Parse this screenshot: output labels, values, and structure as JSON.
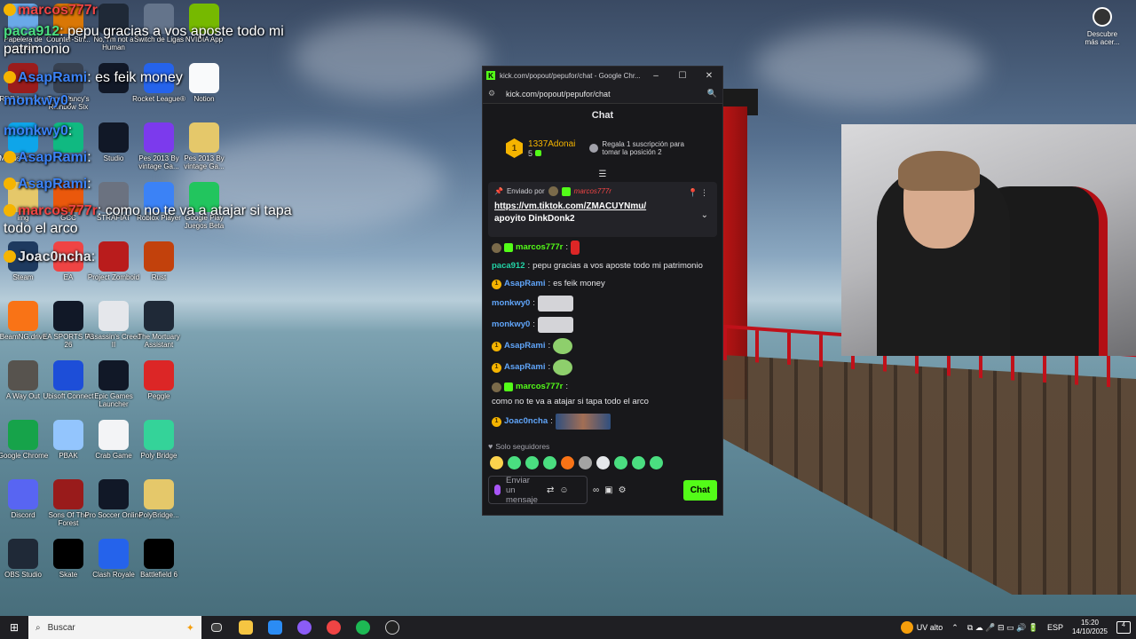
{
  "desktop": {
    "icons": [
      {
        "label": "Papelera de reciclaje",
        "color": "#6aa9e9"
      },
      {
        "label": "Counter-Stri...",
        "color": "#d97706"
      },
      {
        "label": "No, I'm not a Human",
        "color": "#1f2937"
      },
      {
        "label": "Switch de Ligas",
        "color": "#64748b"
      },
      {
        "label": "NVIDIA App",
        "color": "#76b900"
      },
      {
        "label": "RDR Launcher",
        "color": "#9b1c1c"
      },
      {
        "label": "Tom Clancy's Rainbow Six",
        "color": "#374151"
      },
      {
        "label": "",
        "color": "#111827"
      },
      {
        "label": "Rocket League®",
        "color": "#2563eb"
      },
      {
        "label": "Notion",
        "color": "#f9fafb"
      },
      {
        "label": "Microsoft Edge",
        "color": "#0ea5e9"
      },
      {
        "label": "App",
        "color": "#10b981"
      },
      {
        "label": "Studio",
        "color": "#111827"
      },
      {
        "label": "Pes 2013 By vintage Ga...",
        "color": "#7c3aed"
      },
      {
        "label": "Pes 2013 By vintage Ga...",
        "color": "#e5c86a"
      },
      {
        "label": "img",
        "color": "#e5c86a"
      },
      {
        "label": "GCC",
        "color": "#ea580c"
      },
      {
        "label": "STRAFIAT",
        "color": "#6b7280"
      },
      {
        "label": "Roblox Player",
        "color": "#3b82f6"
      },
      {
        "label": "Google Play Juegos Beta",
        "color": "#22c55e"
      },
      {
        "label": "Steam",
        "color": "#1e3a5f"
      },
      {
        "label": "EA",
        "color": "#ef4444"
      },
      {
        "label": "Project Zomboid",
        "color": "#b91c1c"
      },
      {
        "label": "Rust",
        "color": "#c2410c"
      },
      {
        "label": "BeamNG.drive",
        "color": "#f97316"
      },
      {
        "label": "EA SPORTS FC 26",
        "color": "#111827"
      },
      {
        "label": "Assassin's Creed II",
        "color": "#e5e7eb"
      },
      {
        "label": "The Mortuary Assistant",
        "color": "#1f2937"
      },
      {
        "label": "A Way Out",
        "color": "#57534e"
      },
      {
        "label": "Ubisoft Connect",
        "color": "#1d4ed8"
      },
      {
        "label": "Epic Games Launcher",
        "color": "#111827"
      },
      {
        "label": "Peggle",
        "color": "#dc2626"
      },
      {
        "label": "Google Chrome",
        "color": "#16a34a"
      },
      {
        "label": "PBAK",
        "color": "#93c5fd"
      },
      {
        "label": "Crab Game",
        "color": "#f3f4f6"
      },
      {
        "label": "Poly Bridge",
        "color": "#34d399"
      },
      {
        "label": "Discord",
        "color": "#5865f2"
      },
      {
        "label": "Sons Of The Forest",
        "color": "#991b1b"
      },
      {
        "label": "Pro Soccer Online",
        "color": "#111827"
      },
      {
        "label": "PolyBridge...",
        "color": "#e5c86a"
      },
      {
        "label": "OBS Studio",
        "color": "#1f2937"
      },
      {
        "label": "Skate",
        "color": "#000000"
      },
      {
        "label": "Clash Royale",
        "color": "#2563eb"
      },
      {
        "label": "Battlefield 6",
        "color": "#000000"
      }
    ],
    "discover": "Descubre más acer..."
  },
  "overlay": [
    {
      "name": "marcos777r",
      "text": ""
    },
    {
      "name": "paca912",
      "text": "pepu gracias a vos aposte todo mi patrimonio"
    },
    {
      "name": "AsapRami",
      "text": "es feik money"
    },
    {
      "name": "monkwy0",
      "text": ""
    },
    {
      "name": "monkwy0",
      "text": ""
    },
    {
      "name": "AsapRami",
      "text": ""
    },
    {
      "name": "AsapRami",
      "text": ""
    },
    {
      "name": "marcos777r",
      "text": "como no te va a atajar si tapa todo el arco"
    },
    {
      "name": "Joac0ncha",
      "text": ""
    }
  ],
  "browser": {
    "title": "kick.com/popout/pepufor/chat - Google Chr...",
    "url": "kick.com/popout/pepufor/chat",
    "chat_title": "Chat",
    "leader": {
      "name": "1337Adonai",
      "count": "5",
      "rank": "1",
      "gift_text": "Regala 1 suscripción para tomar la posición 2"
    },
    "pinned": {
      "sent_by": "Enviado por",
      "user": "marcos777r",
      "link": "https://vm.tiktok.com/ZMACUYNmu/",
      "text": "apoyito DinkDonk2"
    },
    "messages": [
      {
        "user": "marcos777r",
        "text": ""
      },
      {
        "user": "paca912",
        "text": "pepu gracias a vos aposte todo mi patrimonio"
      },
      {
        "user": "AsapRami",
        "text": "es feik money"
      },
      {
        "user": "monkwy0",
        "text": ""
      },
      {
        "user": "monkwy0",
        "text": ""
      },
      {
        "user": "AsapRami",
        "text": ""
      },
      {
        "user": "AsapRami",
        "text": ""
      },
      {
        "user": "marcos777r",
        "text": "como no te va a atajar si tapa todo el arco"
      },
      {
        "user": "Joac0ncha",
        "text": ""
      }
    ],
    "followers_only": "Solo seguidores",
    "input_placeholder": "Enviar un mensaje",
    "send_label": "Chat"
  },
  "taskbar": {
    "search_placeholder": "Buscar",
    "uv": "UV alto",
    "lang": "ESP",
    "time": "15:20",
    "date": "14/10/2025",
    "notifications": "4"
  }
}
